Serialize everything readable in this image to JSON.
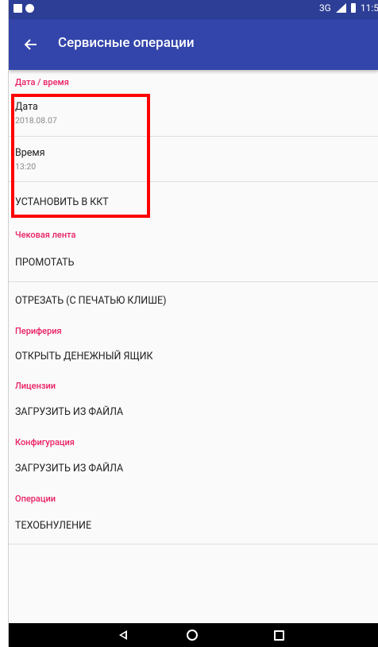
{
  "status_bar": {
    "network": "3G",
    "time": "11:5"
  },
  "app_bar": {
    "title": "Сервисные операции"
  },
  "sections": {
    "datetime": {
      "header": "Дата / время",
      "date": {
        "label": "Дата",
        "value": "2018.08.07"
      },
      "time": {
        "label": "Время",
        "value": "13:20"
      },
      "set_action": "УСТАНОВИТЬ В ККТ"
    },
    "receipt_tape": {
      "header": "Чековая лента",
      "feed": "ПРОМОТАТЬ",
      "cut": "ОТРЕЗАТЬ (С ПЕЧАТЬЮ КЛИШЕ)"
    },
    "periphery": {
      "header": "Периферия",
      "open_drawer": "ОТКРЫТЬ ДЕНЕЖНЫЙ ЯЩИК"
    },
    "licenses": {
      "header": "Лицензии",
      "load": "ЗАГРУЗИТЬ ИЗ ФАЙЛА"
    },
    "configuration": {
      "header": "Конфигурация",
      "load": "ЗАГРУЗИТЬ ИЗ ФАЙЛА"
    },
    "operations": {
      "header": "Операции",
      "reset": "ТЕХОБНУЛЕНИЕ"
    }
  },
  "colors": {
    "app_bar": "#3344aa",
    "status_bar": "#2c3e95",
    "section_header": "#e91e63",
    "highlight": "#ff0000"
  },
  "icons": {
    "back": "arrow-left-icon",
    "nav_back": "triangle-back-icon",
    "nav_home": "circle-home-icon",
    "nav_recent": "square-recent-icon"
  }
}
